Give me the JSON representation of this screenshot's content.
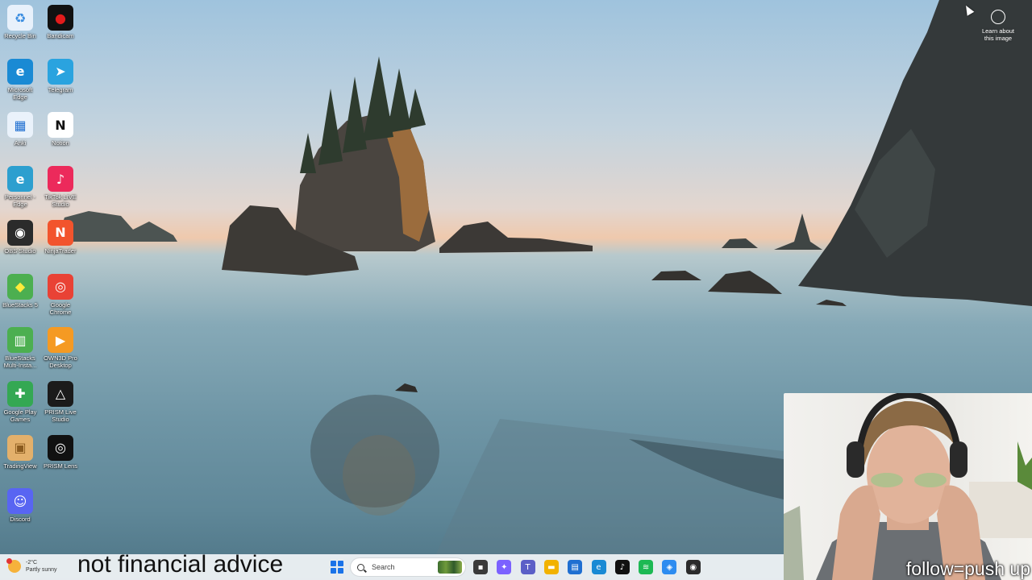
{
  "desktop": {
    "icons": [
      {
        "label": "Recycle Bin",
        "glyph": "♻",
        "color": "#e8f1fb",
        "fg": "#3a8de0"
      },
      {
        "label": "Bandicam",
        "glyph": "●",
        "color": "#111111",
        "fg": "#e21b1b"
      },
      {
        "label": "Microsoft Edge",
        "glyph": "e",
        "color": "#1a8ad4",
        "fg": "#ffffff"
      },
      {
        "label": "Telegram",
        "glyph": "➤",
        "color": "#2aa3df",
        "fg": "#ffffff"
      },
      {
        "label": "Anki",
        "glyph": "▦",
        "color": "#eaf2fb",
        "fg": "#1f6fd1"
      },
      {
        "label": "Notion",
        "glyph": "N",
        "color": "#ffffff",
        "fg": "#111111"
      },
      {
        "label": "Personnel - Edge",
        "glyph": "e",
        "color": "#2d9fcf",
        "fg": "#ffffff"
      },
      {
        "label": "TikTok LIVE Studio",
        "glyph": "♪",
        "color": "#ec2a5b",
        "fg": "#ffffff"
      },
      {
        "label": "OBS Studio",
        "glyph": "◉",
        "color": "#2b2b2b",
        "fg": "#ffffff"
      },
      {
        "label": "NinjaTrader",
        "glyph": "N",
        "color": "#f2542d",
        "fg": "#ffffff"
      },
      {
        "label": "BlueStacks 5",
        "glyph": "◆",
        "color": "#4caf50",
        "fg": "#ffeb3b"
      },
      {
        "label": "Google Chrome",
        "glyph": "◎",
        "color": "#e94235",
        "fg": "#ffffff"
      },
      {
        "label": "BlueStacks Multi-Insta...",
        "glyph": "▥",
        "color": "#4caf50",
        "fg": "#ffffff"
      },
      {
        "label": "OWN3D Pro Desktop",
        "glyph": "▶",
        "color": "#f59a23",
        "fg": "#ffffff"
      },
      {
        "label": "Google Play Games",
        "glyph": "✚",
        "color": "#34a853",
        "fg": "#ffffff"
      },
      {
        "label": "PRISM Live Studio",
        "glyph": "△",
        "color": "#1b1b1b",
        "fg": "#ffffff"
      },
      {
        "label": "TradingView",
        "glyph": "▣",
        "color": "#e3b06b",
        "fg": "#8a5a1e"
      },
      {
        "label": "PRISM Lens",
        "glyph": "◎",
        "color": "#111111",
        "fg": "#ffffff"
      },
      {
        "label": "Discord",
        "glyph": "☺",
        "color": "#5865f2",
        "fg": "#ffffff"
      }
    ]
  },
  "learn_about": {
    "line1": "Learn about",
    "line2": "this image"
  },
  "caption": "not financial advice",
  "webcam": {
    "overlay": "follow=push up"
  },
  "taskbar": {
    "weather": {
      "temp": "-2°C",
      "condition": "Partly sunny"
    },
    "search_placeholder": "Search",
    "apps": [
      {
        "name": "task-view",
        "glyph": "▪",
        "color": "#3a3a3a"
      },
      {
        "name": "copilot",
        "glyph": "✦",
        "color": "#7b61ff"
      },
      {
        "name": "teams",
        "glyph": "T",
        "color": "#5b5fc7"
      },
      {
        "name": "file-explorer",
        "glyph": "▬",
        "color": "#f2b200"
      },
      {
        "name": "store",
        "glyph": "▤",
        "color": "#1f6fd1"
      },
      {
        "name": "edge",
        "glyph": "e",
        "color": "#1a8ad4"
      },
      {
        "name": "tiktok",
        "glyph": "♪",
        "color": "#111111"
      },
      {
        "name": "spotify",
        "glyph": "≋",
        "color": "#1db954"
      },
      {
        "name": "app-blue",
        "glyph": "◈",
        "color": "#2d8cf0"
      },
      {
        "name": "obs",
        "glyph": "◉",
        "color": "#2b2b2b"
      }
    ]
  }
}
